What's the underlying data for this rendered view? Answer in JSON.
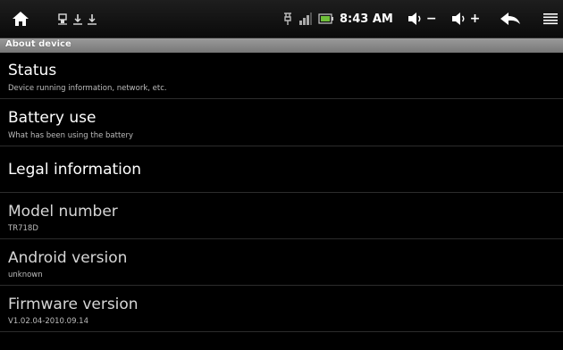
{
  "status_bar": {
    "time": "8:43 AM",
    "vol_down_label": "−",
    "vol_up_label": "+",
    "icons": [
      "home-icon",
      "usb-icon",
      "download-icon",
      "download-icon",
      "usb-debug-icon",
      "signal-icon",
      "battery-icon",
      "volume-down-icon",
      "volume-up-icon",
      "back-icon",
      "menu-icon"
    ]
  },
  "header": {
    "title": "About device"
  },
  "items": [
    {
      "title": "Status",
      "subtitle": "Device running information, network, etc."
    },
    {
      "title": "Battery use",
      "subtitle": "What has been using the battery"
    },
    {
      "title": "Legal information",
      "subtitle": ""
    },
    {
      "title": "Model number",
      "subtitle": "TR718D"
    },
    {
      "title": "Android version",
      "subtitle": "unknown"
    },
    {
      "title": "Firmware version",
      "subtitle": "V1.02.04-2010.09.14"
    }
  ],
  "colors": {
    "background": "#000000",
    "header_gray": "#8a8a8a",
    "divider": "#2c2c2c",
    "subtitle": "#bdbdbd"
  }
}
